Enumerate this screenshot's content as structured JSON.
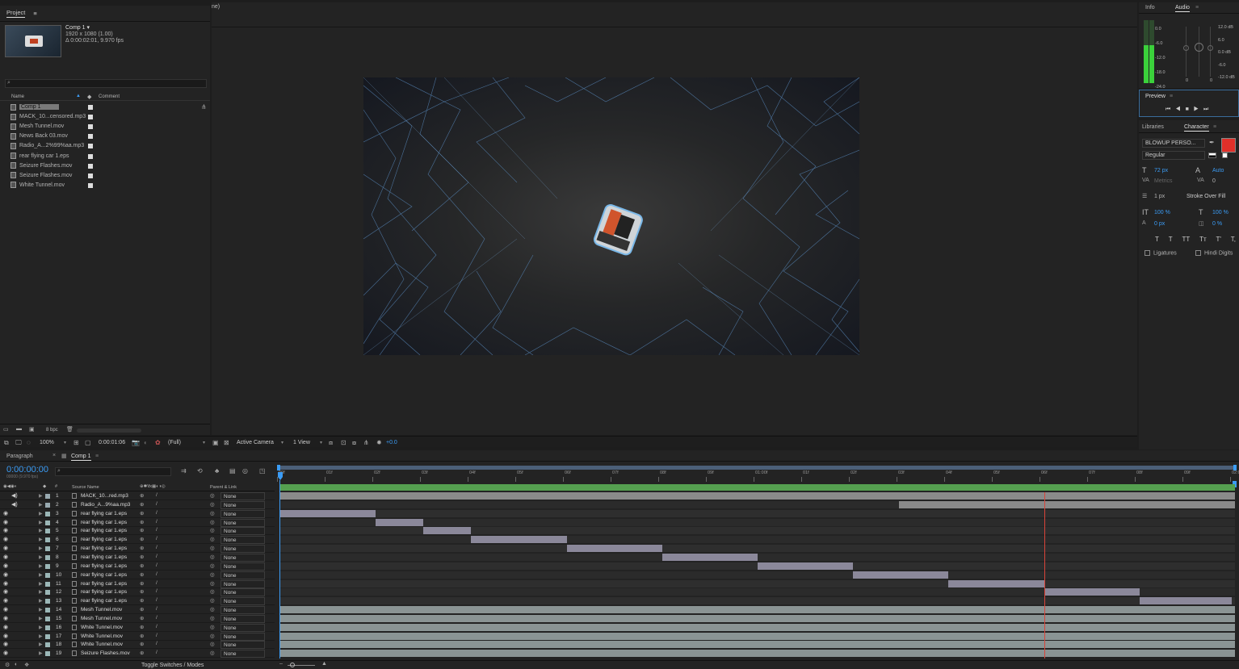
{
  "window": {
    "title_fragment": "ne)"
  },
  "project": {
    "title": "Project",
    "comp_name": "Comp 1 ▾",
    "comp_size": "1920 x 1080 (1.00)",
    "comp_dur": "Δ 0:00:02:01, 9.970 fps",
    "search_placeholder": "",
    "col_name": "Name",
    "col_comment": "Comment",
    "items": [
      "Comp 1",
      "MACK_10...censored.mp3",
      "Mesh Tunnel.mov",
      "News Back 03.mov",
      "Radio_A...2%99%aa.mp3",
      "rear flying car 1.eps",
      "Seizure Flashes.mov",
      "Seizure Flashes.mov",
      "White Tunnel.mov"
    ],
    "bpc": "8 bpc"
  },
  "viewer": {
    "zoom": "100%",
    "timecode": "0:00:01:06",
    "resolution": "(Full)",
    "camera": "Active Camera",
    "views": "1 View",
    "exposure": "+0.0"
  },
  "info": {
    "tab_info": "Info",
    "tab_audio": "Audio",
    "levels_left": [
      "0.0",
      "-6.0",
      "-12.0",
      "-18.0",
      "-24.0"
    ],
    "levels_right": [
      "12.0 dB",
      "6.0",
      "0.0 dB",
      "-6.0",
      "-12.0 dB"
    ],
    "small_zero_a": "0",
    "small_zero_b": "0"
  },
  "preview": {
    "title": "Preview"
  },
  "character": {
    "tab_libraries": "Libraries",
    "tab_character": "Character",
    "font": "BLOWUP PERSO...",
    "style": "Regular",
    "size": "72 px",
    "leading": "Auto",
    "kerning": "Metrics",
    "tracking": "0",
    "stroke_width": "1 px",
    "stroke_type": "Stroke Over Fill",
    "vscale": "100 %",
    "hscale": "100 %",
    "baseline": "0 px",
    "tsume": "0 %",
    "style_btns": [
      "T",
      "T",
      "TT",
      "Tт",
      "T'",
      "T,"
    ],
    "ligatures": "Ligatures",
    "hindi": "Hindi Digits",
    "fill_color": "#e0302a"
  },
  "timeline": {
    "tab_paragraph": "Paragraph",
    "tab_comp": "Comp 1",
    "timecode": "0:00:00:00",
    "fps": "00000 (9.970 fps)",
    "col_source": "Source Name",
    "col_parent": "Parent & Link",
    "toggle": "Toggle Switches / Modes",
    "ruler": [
      "00f",
      "01f",
      "02f",
      "03f",
      "04f",
      "05f",
      "06f",
      "07f",
      "08f",
      "09f",
      "01:00f",
      "01f",
      "02f",
      "03f",
      "04f",
      "05f",
      "06f",
      "07f",
      "08f",
      "09f",
      "02:00"
    ],
    "layers": [
      {
        "n": "1",
        "name": "MACK_10...red.mp3",
        "parent": "None",
        "audio": true,
        "bar": [
          0,
          1
        ],
        "color": "#8a8a8a"
      },
      {
        "n": "2",
        "name": "Radio_A...9%aa.mp3",
        "parent": "None",
        "audio": true,
        "bar": [
          0.648,
          1
        ],
        "color": "#8a8a8a"
      },
      {
        "n": "3",
        "name": "rear flying car 1.eps",
        "parent": "None",
        "bar": [
          0,
          0.1
        ],
        "color": "#8b889a"
      },
      {
        "n": "4",
        "name": "rear flying car 1.eps",
        "parent": "None",
        "bar": [
          0.1,
          0.15
        ],
        "color": "#8b889a"
      },
      {
        "n": "5",
        "name": "rear flying car 1.eps",
        "parent": "None",
        "bar": [
          0.15,
          0.2
        ],
        "color": "#8b889a"
      },
      {
        "n": "6",
        "name": "rear flying car 1.eps",
        "parent": "None",
        "bar": [
          0.2,
          0.3
        ],
        "color": "#8b889a"
      },
      {
        "n": "7",
        "name": "rear flying car 1.eps",
        "parent": "None",
        "bar": [
          0.3,
          0.4
        ],
        "color": "#8b889a"
      },
      {
        "n": "8",
        "name": "rear flying car 1.eps",
        "parent": "None",
        "bar": [
          0.4,
          0.5
        ],
        "color": "#8b889a"
      },
      {
        "n": "9",
        "name": "rear flying car 1.eps",
        "parent": "None",
        "bar": [
          0.5,
          0.6
        ],
        "color": "#8b889a"
      },
      {
        "n": "10",
        "name": "rear flying car 1.eps",
        "parent": "None",
        "bar": [
          0.6,
          0.7
        ],
        "color": "#8b889a"
      },
      {
        "n": "11",
        "name": "rear flying car 1.eps",
        "parent": "None",
        "bar": [
          0.7,
          0.8
        ],
        "color": "#8b889a"
      },
      {
        "n": "12",
        "name": "rear flying car 1.eps",
        "parent": "None",
        "bar": [
          0.8,
          0.9
        ],
        "color": "#8b889a"
      },
      {
        "n": "13",
        "name": "rear flying car 1.eps",
        "parent": "None",
        "bar": [
          0.9,
          0.997
        ],
        "color": "#8b889a"
      },
      {
        "n": "14",
        "name": "Mesh Tunnel.mov",
        "parent": "None",
        "bar": [
          0,
          1
        ],
        "color": "#8a9494"
      },
      {
        "n": "15",
        "name": "Mesh Tunnel.mov",
        "parent": "None",
        "bar": [
          0,
          1
        ],
        "color": "#8a9494"
      },
      {
        "n": "16",
        "name": "White Tunnel.mov",
        "parent": "None",
        "bar": [
          0,
          1
        ],
        "color": "#8a9494"
      },
      {
        "n": "17",
        "name": "White Tunnel.mov",
        "parent": "None",
        "bar": [
          0,
          1
        ],
        "color": "#8a9494"
      },
      {
        "n": "18",
        "name": "White Tunnel.mov",
        "parent": "None",
        "bar": [
          0,
          1
        ],
        "color": "#8a9494"
      },
      {
        "n": "19",
        "name": "Seizure Flashes.mov",
        "parent": "None",
        "bar": [
          0,
          1
        ],
        "color": "#8a9494"
      }
    ],
    "playhead": 0.8
  }
}
